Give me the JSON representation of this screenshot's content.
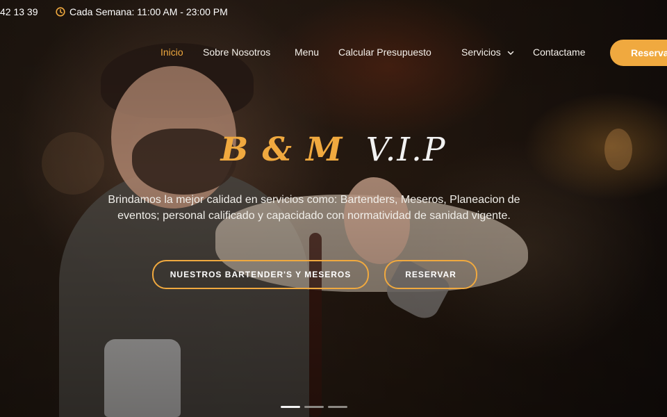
{
  "topbar": {
    "phone": "42 13 39",
    "hours": "Cada Semana: 11:00 AM - 23:00 PM"
  },
  "nav": {
    "items": [
      {
        "label": "Inicio",
        "active": true
      },
      {
        "label": "Sobre Nosotros",
        "active": false
      },
      {
        "label": "Menu",
        "active": false
      },
      {
        "label": "Calcular Presupuesto",
        "active": false
      },
      {
        "label": "Servicios",
        "active": false,
        "has_dropdown": true
      },
      {
        "label": "Contactame",
        "active": false
      }
    ],
    "cta": "Reservar"
  },
  "hero": {
    "brand_left": "B & M",
    "brand_right": "V.I.P",
    "description": "Brindamos la mejor calidad en servicios como: Bartenders, Meseros, Planeacion de eventos; personal calificado y capacidado con normatividad de sanidad vigente.",
    "primary_button": "NUESTROS BARTENDER'S Y MESEROS",
    "secondary_button": "RESERVAR"
  },
  "carousel": {
    "active_index": 0,
    "count": 3
  },
  "theme": {
    "accent": "#f0a93f",
    "text": "#ffffff",
    "muted": "#8c8883"
  },
  "icons": {
    "clock": "clock-icon",
    "dropdown": "chevron-down-icon"
  }
}
